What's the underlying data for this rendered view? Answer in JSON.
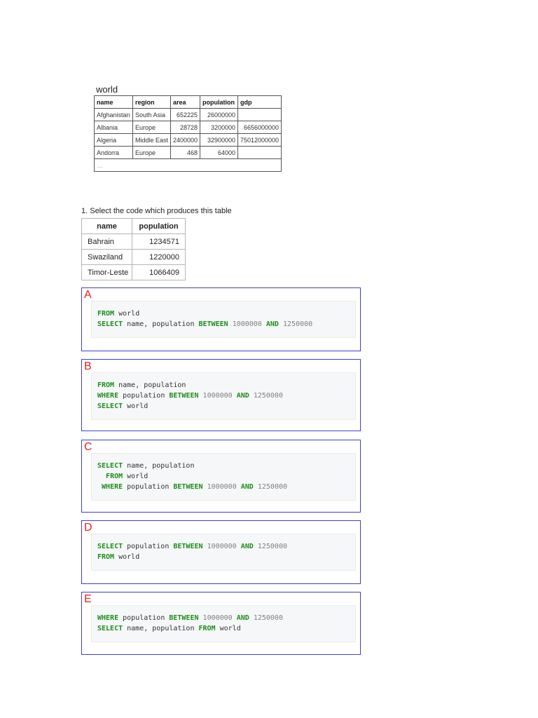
{
  "world_table": {
    "caption": "world",
    "columns": [
      "name",
      "region",
      "area",
      "population",
      "gdp"
    ],
    "rows": [
      [
        "Afghanistan",
        "South Asia",
        "652225",
        "26000000",
        ""
      ],
      [
        "Albania",
        "Europe",
        "28728",
        "3200000",
        "6656000000"
      ],
      [
        "Algeria",
        "Middle East",
        "2400000",
        "32900000",
        "75012000000"
      ],
      [
        "Andorra",
        "Europe",
        "468",
        "64000",
        ""
      ]
    ],
    "ellipsis": "..."
  },
  "question": {
    "text": "1. Select the code which produces this table",
    "result_table": {
      "columns": [
        "name",
        "population"
      ],
      "rows": [
        [
          "Bahrain",
          "1234571"
        ],
        [
          "Swaziland",
          "1220000"
        ],
        [
          "Timor-Leste",
          "1066409"
        ]
      ]
    }
  },
  "options": [
    {
      "letter": "A",
      "code": [
        "FROM world",
        "SELECT name, population BETWEEN 1000000 AND 1250000"
      ]
    },
    {
      "letter": "B",
      "code": [
        "FROM name, population",
        "WHERE population BETWEEN 1000000 AND 1250000",
        "SELECT world"
      ]
    },
    {
      "letter": "C",
      "code": [
        "SELECT name, population",
        "  FROM world",
        " WHERE population BETWEEN 1000000 AND 1250000"
      ]
    },
    {
      "letter": "D",
      "code": [
        "SELECT population BETWEEN 1000000 AND 1250000",
        "FROM world"
      ]
    },
    {
      "letter": "E",
      "code": [
        "WHERE population BETWEEN 1000000 AND 1250000",
        "SELECT name, population FROM world"
      ]
    }
  ],
  "colors": {
    "option_border": "#3f3fd0",
    "option_letter": "#e8231b",
    "sql_keyword": "#1a8f1a",
    "sql_number": "#808080",
    "code_background": "#f6f7f8"
  }
}
